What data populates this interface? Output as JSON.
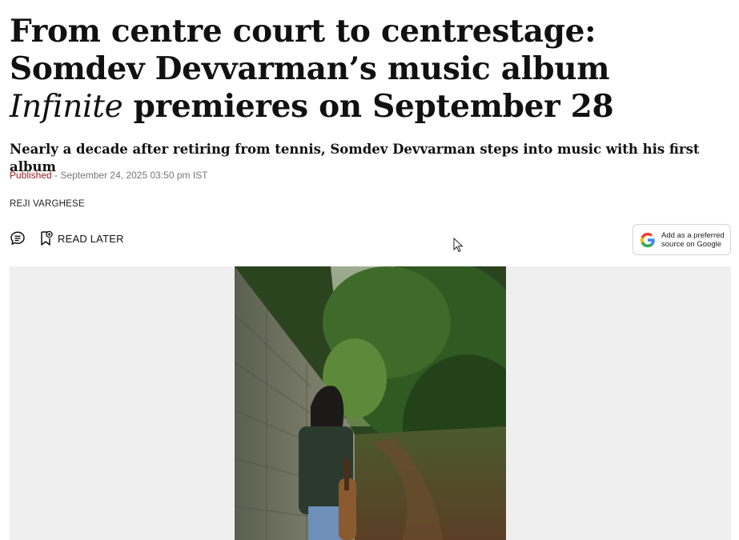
{
  "article": {
    "headline_part1": "From centre court to centrestage: Somdev Devvarman’s music album ",
    "headline_italic": "Infinite",
    "headline_part2": " premieres on September 28",
    "standfirst": "Nearly a decade after retiring from tennis, Somdev Devvarman steps into music with his first album",
    "published_label": "Published",
    "published_sep": " - ",
    "published_date": "September 24, 2025 03:50 pm IST",
    "author": "REJI VARGHESE"
  },
  "actions": {
    "read_later": "READ LATER",
    "comment_icon": "comment-icon",
    "bookmark_icon": "bookmark-add-icon"
  },
  "preferred_source": {
    "line1": "Add as a preferred",
    "line2": "source on Google",
    "icon": "google-g-icon"
  },
  "colors": {
    "published_accent": "#9b1c1c",
    "media_background": "#efefef"
  }
}
